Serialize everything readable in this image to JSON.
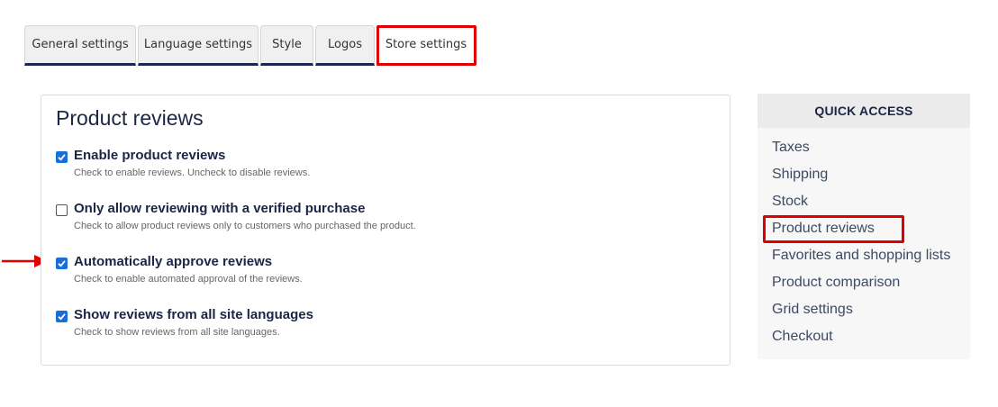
{
  "tabs": [
    {
      "label": "General settings"
    },
    {
      "label": "Language settings"
    },
    {
      "label": "Style"
    },
    {
      "label": "Logos"
    },
    {
      "label": "Store settings"
    }
  ],
  "panel": {
    "title": "Product reviews",
    "options": [
      {
        "label": "Enable product reviews",
        "help": "Check to enable reviews. Uncheck to disable reviews.",
        "checked": true
      },
      {
        "label": "Only allow reviewing with a verified purchase",
        "help": "Check to allow product reviews only to customers who purchased the product.",
        "checked": false
      },
      {
        "label": "Automatically approve reviews",
        "help": "Check to enable automated approval of the reviews.",
        "checked": true
      },
      {
        "label": "Show reviews from all site languages",
        "help": "Check to show reviews from all site languages.",
        "checked": true
      }
    ]
  },
  "quick_access": {
    "title": "QUICK ACCESS",
    "items": [
      {
        "label": "Taxes"
      },
      {
        "label": "Shipping"
      },
      {
        "label": "Stock"
      },
      {
        "label": "Product reviews"
      },
      {
        "label": "Favorites and shopping lists"
      },
      {
        "label": "Product comparison"
      },
      {
        "label": "Grid settings"
      },
      {
        "label": "Checkout"
      }
    ]
  },
  "colors": {
    "accent": "#1a2750",
    "checkbox": "#1a6fd6",
    "highlight": "#e00000"
  }
}
